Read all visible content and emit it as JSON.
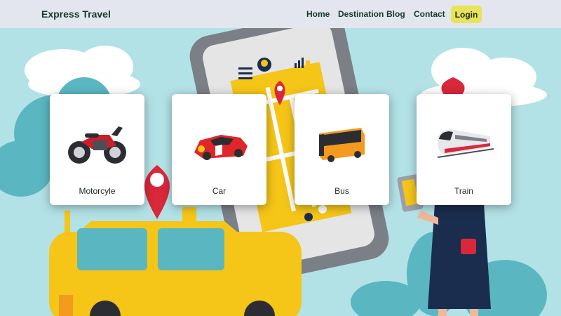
{
  "brand": "Express Travel",
  "nav": {
    "links": [
      "Home",
      "Destination",
      "Blog",
      "Contact"
    ],
    "login": "Login"
  },
  "cards": [
    {
      "label": "Motorcyle",
      "icon": "motorcycle-icon"
    },
    {
      "label": "Car",
      "icon": "car-icon"
    },
    {
      "label": "Bus",
      "icon": "bus-icon"
    },
    {
      "label": "Train",
      "icon": "train-icon"
    }
  ],
  "colors": {
    "navbar": "#e3e6ee",
    "login_bg": "#e8e45a",
    "background": "#b3e2e6",
    "accent_yellow": "#f5c518",
    "accent_red": "#d8283a"
  }
}
